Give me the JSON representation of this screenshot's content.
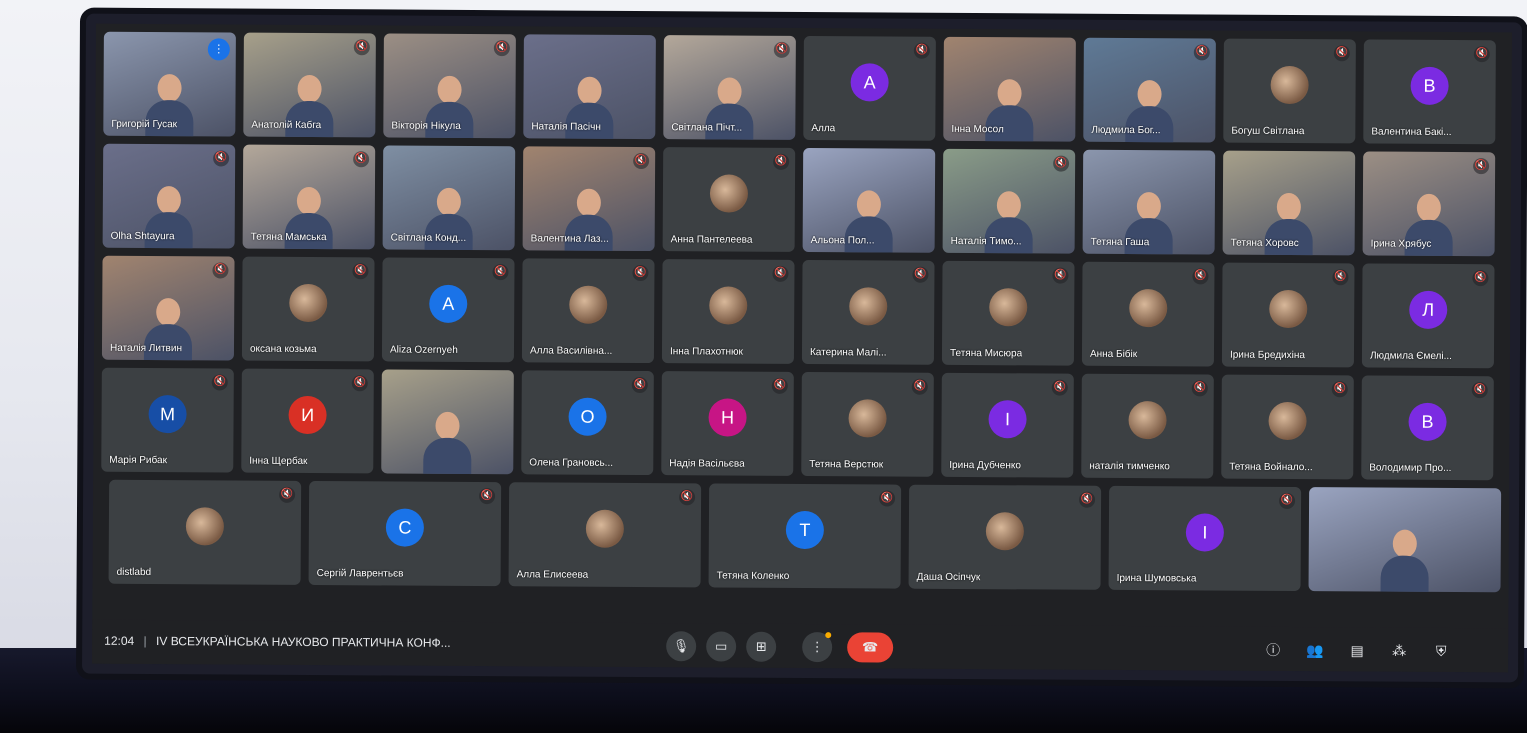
{
  "meeting": {
    "time": "12:04",
    "separator": "|",
    "title": "IV ВСЕУКРАЇНСЬКА НАУКОВО ПРАКТИЧНА КОНФ..."
  },
  "rows": [
    [
      {
        "name": "Григорій Гусак",
        "type": "camera",
        "status": "speaking"
      },
      {
        "name": "Анатолій Кабга",
        "type": "camera",
        "status": "muted"
      },
      {
        "name": "Вікторія Нікула",
        "type": "camera",
        "status": "muted"
      },
      {
        "name": "Наталія Пасічн",
        "type": "camera",
        "status": "none"
      },
      {
        "name": "Світлана Пічт...",
        "type": "camera",
        "status": "muted"
      },
      {
        "name": "Алла",
        "type": "letter",
        "letter": "А",
        "color": "#7b2be2",
        "status": "muted"
      },
      {
        "name": "Інна Мосол",
        "type": "camera",
        "status": "none"
      },
      {
        "name": "Людмила Бог...",
        "type": "camera",
        "status": "muted"
      },
      {
        "name": "Богуш Світлана",
        "type": "photo",
        "status": "muted"
      },
      {
        "name": "Валентина Бакі...",
        "type": "letter",
        "letter": "В",
        "color": "#7b2be2",
        "status": "muted"
      }
    ],
    [
      {
        "name": "Olha Shtayura",
        "type": "camera",
        "status": "muted"
      },
      {
        "name": "Тетяна Мамська",
        "type": "camera",
        "status": "muted"
      },
      {
        "name": "Світлана Конд...",
        "type": "camera",
        "status": "none"
      },
      {
        "name": "Валентина Лаз...",
        "type": "camera",
        "status": "muted"
      },
      {
        "name": "Анна Пантелеева",
        "type": "photo",
        "status": "muted"
      },
      {
        "name": "Альона Пол...",
        "type": "camera",
        "status": "none"
      },
      {
        "name": "Наталія Тимо...",
        "type": "camera",
        "status": "muted"
      },
      {
        "name": "Тетяна Гаша",
        "type": "camera",
        "status": "none"
      },
      {
        "name": "Тетяна Хоровс",
        "type": "camera",
        "status": "none"
      },
      {
        "name": "Ірина Хрябус",
        "type": "camera",
        "status": "muted"
      }
    ],
    [
      {
        "name": "Наталія Литвин",
        "type": "camera",
        "status": "muted"
      },
      {
        "name": "оксана козьма",
        "type": "photo",
        "status": "muted"
      },
      {
        "name": "Aliza Ozernyeh",
        "type": "letter",
        "letter": "A",
        "color": "#1a73e8",
        "status": "muted"
      },
      {
        "name": "Алла Василівна...",
        "type": "photo",
        "status": "muted"
      },
      {
        "name": "Інна Плахотнюк",
        "type": "photo",
        "status": "muted"
      },
      {
        "name": "Катерина Малі...",
        "type": "photo",
        "status": "muted"
      },
      {
        "name": "Тетяна Мисюра",
        "type": "photo",
        "status": "muted"
      },
      {
        "name": "Анна Бібік",
        "type": "photo",
        "status": "muted"
      },
      {
        "name": "Ірина Бредихіна",
        "type": "photo",
        "status": "muted"
      },
      {
        "name": "Людмила Ємелі...",
        "type": "letter",
        "letter": "Л",
        "color": "#7b2be2",
        "status": "muted"
      }
    ],
    [
      {
        "name": "Марія Рибак",
        "type": "letter",
        "letter": "М",
        "color": "#174ea6",
        "status": "muted"
      },
      {
        "name": "Інна Щербак",
        "type": "letter",
        "letter": "И",
        "color": "#d93025",
        "status": "muted"
      },
      {
        "name": "",
        "type": "camera",
        "status": "none"
      },
      {
        "name": "Олена Грановсь...",
        "type": "letter",
        "letter": "О",
        "color": "#1a73e8",
        "status": "muted"
      },
      {
        "name": "Надія Васільєва",
        "type": "letter",
        "letter": "Н",
        "color": "#c71585",
        "status": "muted"
      },
      {
        "name": "Тетяна Верстюк",
        "type": "photo",
        "status": "muted"
      },
      {
        "name": "Ірина Дубченко",
        "type": "letter",
        "letter": "І",
        "color": "#7b2be2",
        "status": "muted"
      },
      {
        "name": "наталія тимченко",
        "type": "photo",
        "status": "muted"
      },
      {
        "name": "Тетяна Войнало...",
        "type": "photo",
        "status": "muted"
      },
      {
        "name": "Володимир Про...",
        "type": "letter",
        "letter": "В",
        "color": "#7b2be2",
        "status": "muted"
      }
    ],
    [
      {
        "name": "distlabd",
        "type": "photo",
        "status": "muted"
      },
      {
        "name": "Сергій Лаврентьєв",
        "type": "letter",
        "letter": "С",
        "color": "#1a73e8",
        "status": "muted"
      },
      {
        "name": "Алла Елисеева",
        "type": "photo",
        "status": "muted"
      },
      {
        "name": "Тетяна Коленко",
        "type": "letter",
        "letter": "Т",
        "color": "#1a73e8",
        "status": "muted"
      },
      {
        "name": "Даша Осіпчук",
        "type": "photo",
        "status": "muted"
      },
      {
        "name": "Ірина Шумовська",
        "type": "letter",
        "letter": "І",
        "color": "#7b2be2",
        "status": "muted"
      },
      {
        "name": "",
        "type": "camera",
        "status": "none"
      }
    ]
  ],
  "controls": {
    "mic_icon": "mic-icon",
    "camera_icon": "camera-icon",
    "present_icon": "present-screen-icon",
    "more_icon": "more-options-icon",
    "end_icon": "end-call-icon"
  },
  "right_controls": [
    "info-icon",
    "people-icon",
    "chat-icon",
    "activities-icon",
    "host-controls-icon"
  ],
  "colors": {
    "background": "#202124",
    "tile": "#3c4043",
    "end": "#ea4335",
    "speaking": "#1a73e8"
  }
}
